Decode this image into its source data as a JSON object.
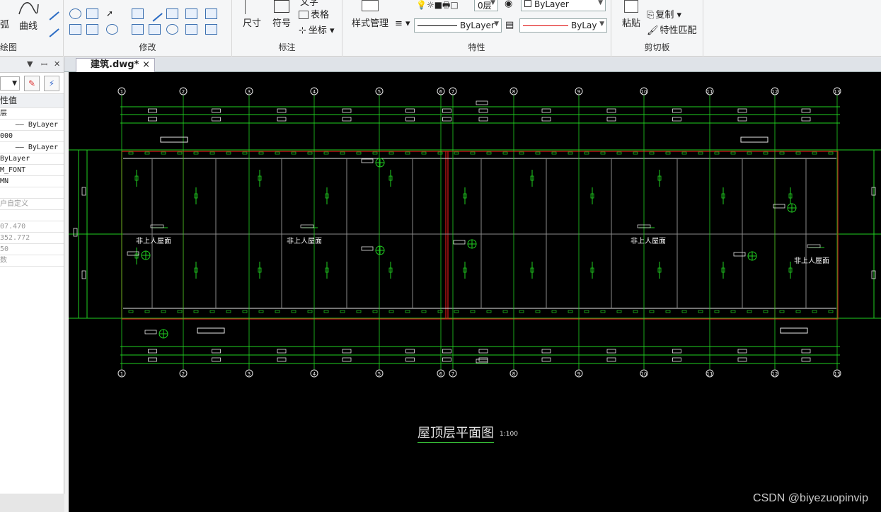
{
  "ribbon": {
    "draw_group": {
      "arc_label": "弧",
      "curve_label": "曲线",
      "group_label": "绘图"
    },
    "modify_group": {
      "group_label": "修改"
    },
    "annotate_group": {
      "dimension_label": "尺寸",
      "symbol_label": "符号",
      "table_label": "表格",
      "coord_label": "坐标",
      "text_label": "文字",
      "group_label": "标注"
    },
    "properties_group": {
      "style_manager_label": "样式管理",
      "layer_value": "0层",
      "color_value": "ByLayer",
      "linetype_value": "ByLayer",
      "lineweight_value": "ByLay",
      "group_label": "特性"
    },
    "clipboard_group": {
      "paste_label": "粘贴",
      "copy_label": "复制",
      "match_label": "特性匹配",
      "group_label": "剪切板"
    }
  },
  "panel": {
    "rows": [
      {
        "text": "性值",
        "type": "head"
      },
      {
        "text": "层",
        "type": "normal"
      },
      {
        "text": "—— ByLayer",
        "type": "right"
      },
      {
        "text": "000",
        "type": "normal"
      },
      {
        "text": "—— ByLayer",
        "type": "right"
      },
      {
        "text": "ByLayer",
        "type": "normal"
      },
      {
        "text": "M_FONT",
        "type": "normal"
      },
      {
        "text": "MN",
        "type": "normal"
      },
      {
        "text": "",
        "type": "normal"
      },
      {
        "text": "户自定义",
        "type": "gray"
      },
      {
        "text": "",
        "type": "normal"
      },
      {
        "text": "07.470",
        "type": "gray"
      },
      {
        "text": "352.772",
        "type": "gray"
      },
      {
        "text": "50",
        "type": "gray"
      },
      {
        "text": "数",
        "type": "gray"
      }
    ]
  },
  "tabs": {
    "active": "建筑.dwg*",
    "close": "×"
  },
  "drawing": {
    "axis_labels": [
      "1",
      "2",
      "3",
      "4",
      "5",
      "6",
      "7",
      "8",
      "9",
      "10",
      "11",
      "12",
      "13"
    ],
    "roof_labels": [
      "非上人屋面",
      "非上人屋面",
      "非上人屋面",
      "非上人屋面"
    ],
    "title": "屋顶层平面图",
    "scale": "1:100"
  },
  "watermark": "CSDN @biyezuopinvip"
}
